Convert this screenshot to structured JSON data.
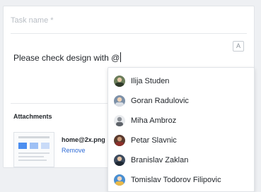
{
  "task": {
    "name_placeholder": "Task name *",
    "format_icon_glyph": "A",
    "editor_text": "Please check design with @"
  },
  "attachments": {
    "title": "Attachments",
    "files": [
      {
        "name": "home@2x.png",
        "remove_label": "Remove"
      }
    ]
  },
  "mentions": [
    {
      "name": "Ilija Studen",
      "avatar_color": "#6b7d5a"
    },
    {
      "name": "Goran Radulovic",
      "avatar_color": "#7d91a8"
    },
    {
      "name": "Miha Ambroz",
      "avatar_color": "#8a8f96"
    },
    {
      "name": "Petar Slavnic",
      "avatar_color": "#5a3a2e"
    },
    {
      "name": "Branislav Zaklan",
      "avatar_color": "#3d4b5e"
    },
    {
      "name": "Tomislav Todorov Filipovic",
      "avatar_color": "#4a8fd1"
    }
  ],
  "colors": {
    "link": "#2e6bd6",
    "placeholder": "#b9bec5",
    "text": "#1f2328"
  }
}
